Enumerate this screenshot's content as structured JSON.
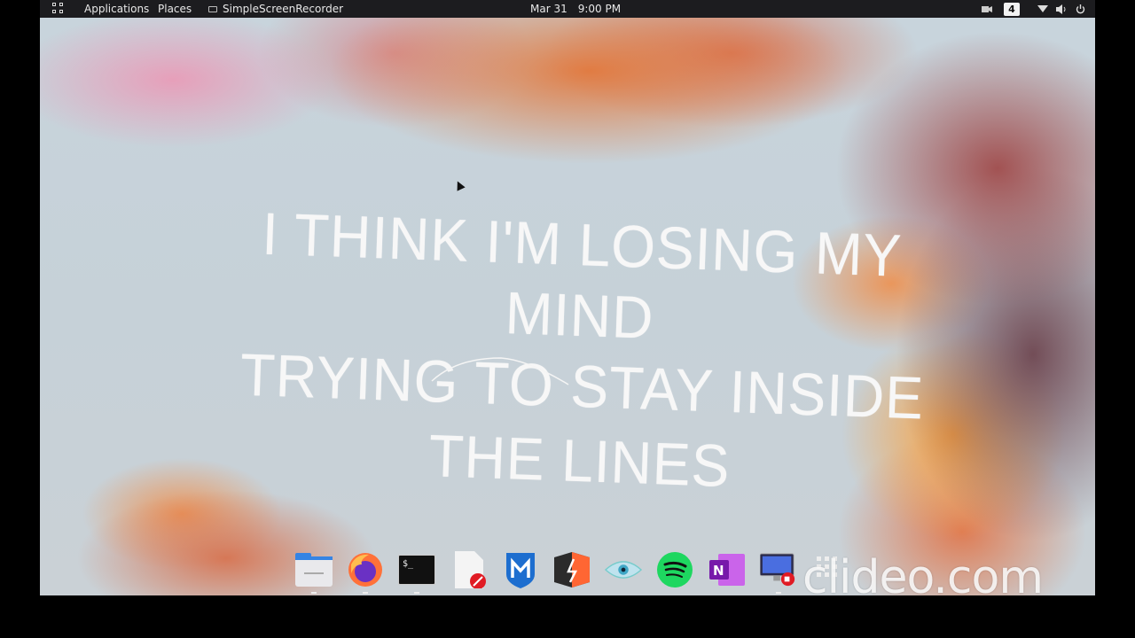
{
  "topbar": {
    "applications": "Applications",
    "places": "Places",
    "active_app": "SimpleScreenRecorder",
    "date": "Mar 31",
    "time": "9:00 PM",
    "workspace": "4"
  },
  "desktop": {
    "lyric_line1": "I THINK I'M LOSING MY MIND",
    "lyric_line2": "TRYING TO STAY INSIDE THE LINES"
  },
  "dock": {
    "items": [
      "files-icon",
      "firefox-icon",
      "terminal-icon",
      "text-editor-icon",
      "metasploit-icon",
      "burpsuite-icon",
      "eye-icon",
      "spotify-icon",
      "onenote-icon",
      "screen-recorder-icon"
    ]
  },
  "watermark": "clideo.com"
}
